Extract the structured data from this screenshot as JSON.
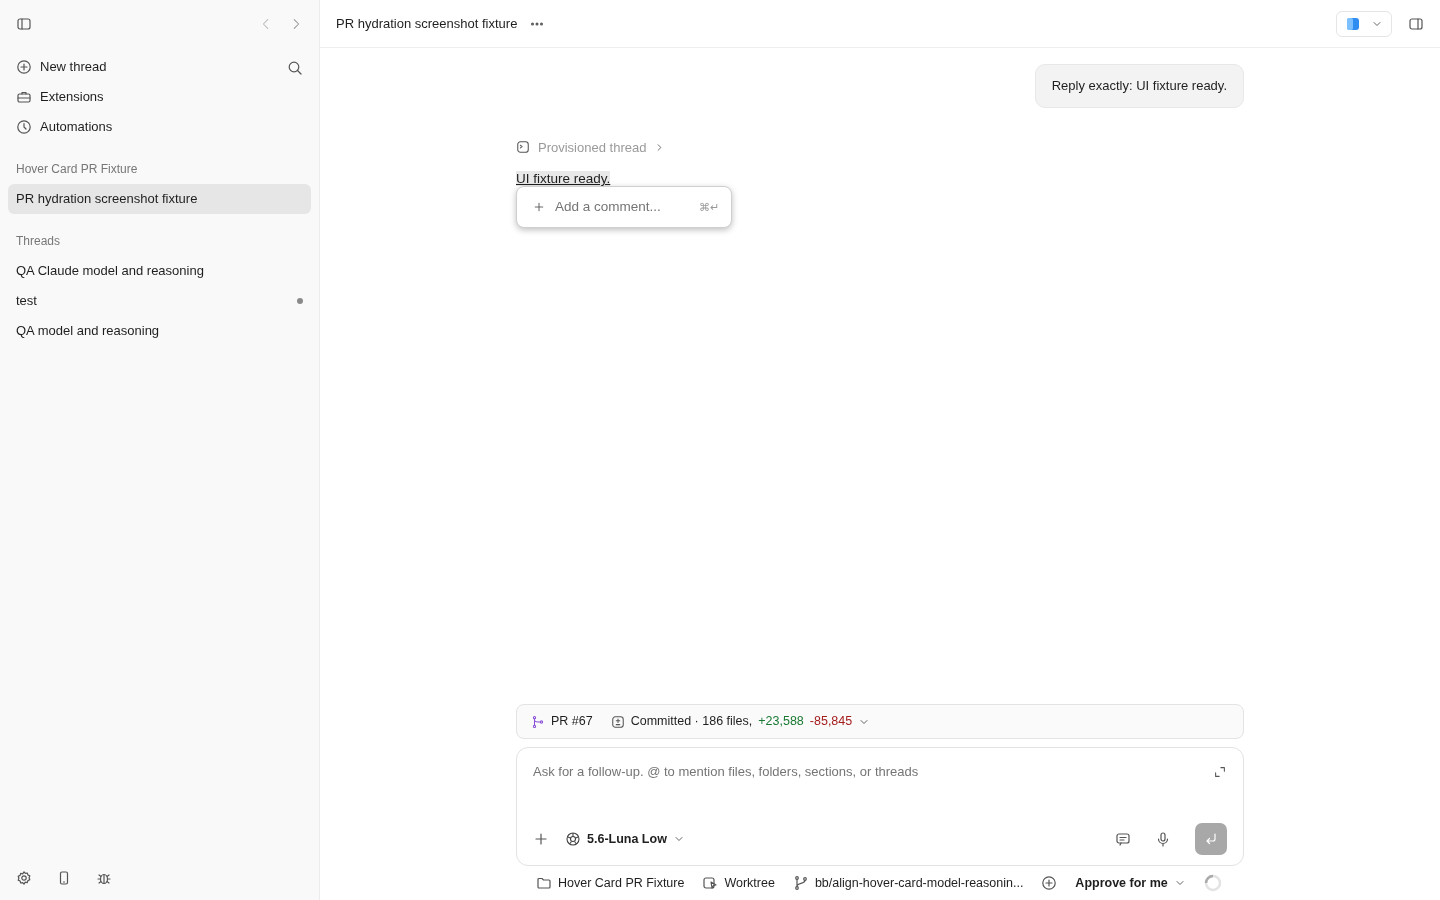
{
  "sidebar": {
    "nav": [
      {
        "label": "New thread",
        "kind": "new"
      },
      {
        "label": "Extensions",
        "kind": "extensions"
      },
      {
        "label": "Automations",
        "kind": "automations"
      }
    ],
    "project": {
      "label": "Hover Card PR Fixture",
      "threads": [
        {
          "title": "PR hydration screenshot fixture",
          "selected": true
        }
      ]
    },
    "threads_header": "Threads",
    "threads": [
      {
        "title": "QA Claude model and reasoning",
        "selected": false,
        "unread": false
      },
      {
        "title": "test",
        "selected": false,
        "unread": true
      },
      {
        "title": "QA model and reasoning",
        "selected": false,
        "unread": false
      }
    ]
  },
  "header": {
    "title": "PR hydration screenshot fixture"
  },
  "conversation": {
    "user_message": "Reply exactly: UI fixture ready.",
    "provisioned": "Provisioned thread",
    "reply": "UI fixture ready.",
    "comment_popover": {
      "placeholder": "Add a comment...",
      "shortcut": "⌘↵"
    }
  },
  "pr_bar": {
    "pr": "PR #67",
    "status": "Committed · 186 files,",
    "additions": "+23,588",
    "deletions": "-85,845"
  },
  "composer": {
    "placeholder": "Ask for a follow-up. @ to mention files, folders, sections, or threads",
    "model": "5.6-Luna Low"
  },
  "footer": {
    "folder": "Hover Card PR Fixture",
    "worktree": "Worktree",
    "branch": "bb/align-hover-card-model-reasonin...",
    "approval": "Approve for me"
  }
}
